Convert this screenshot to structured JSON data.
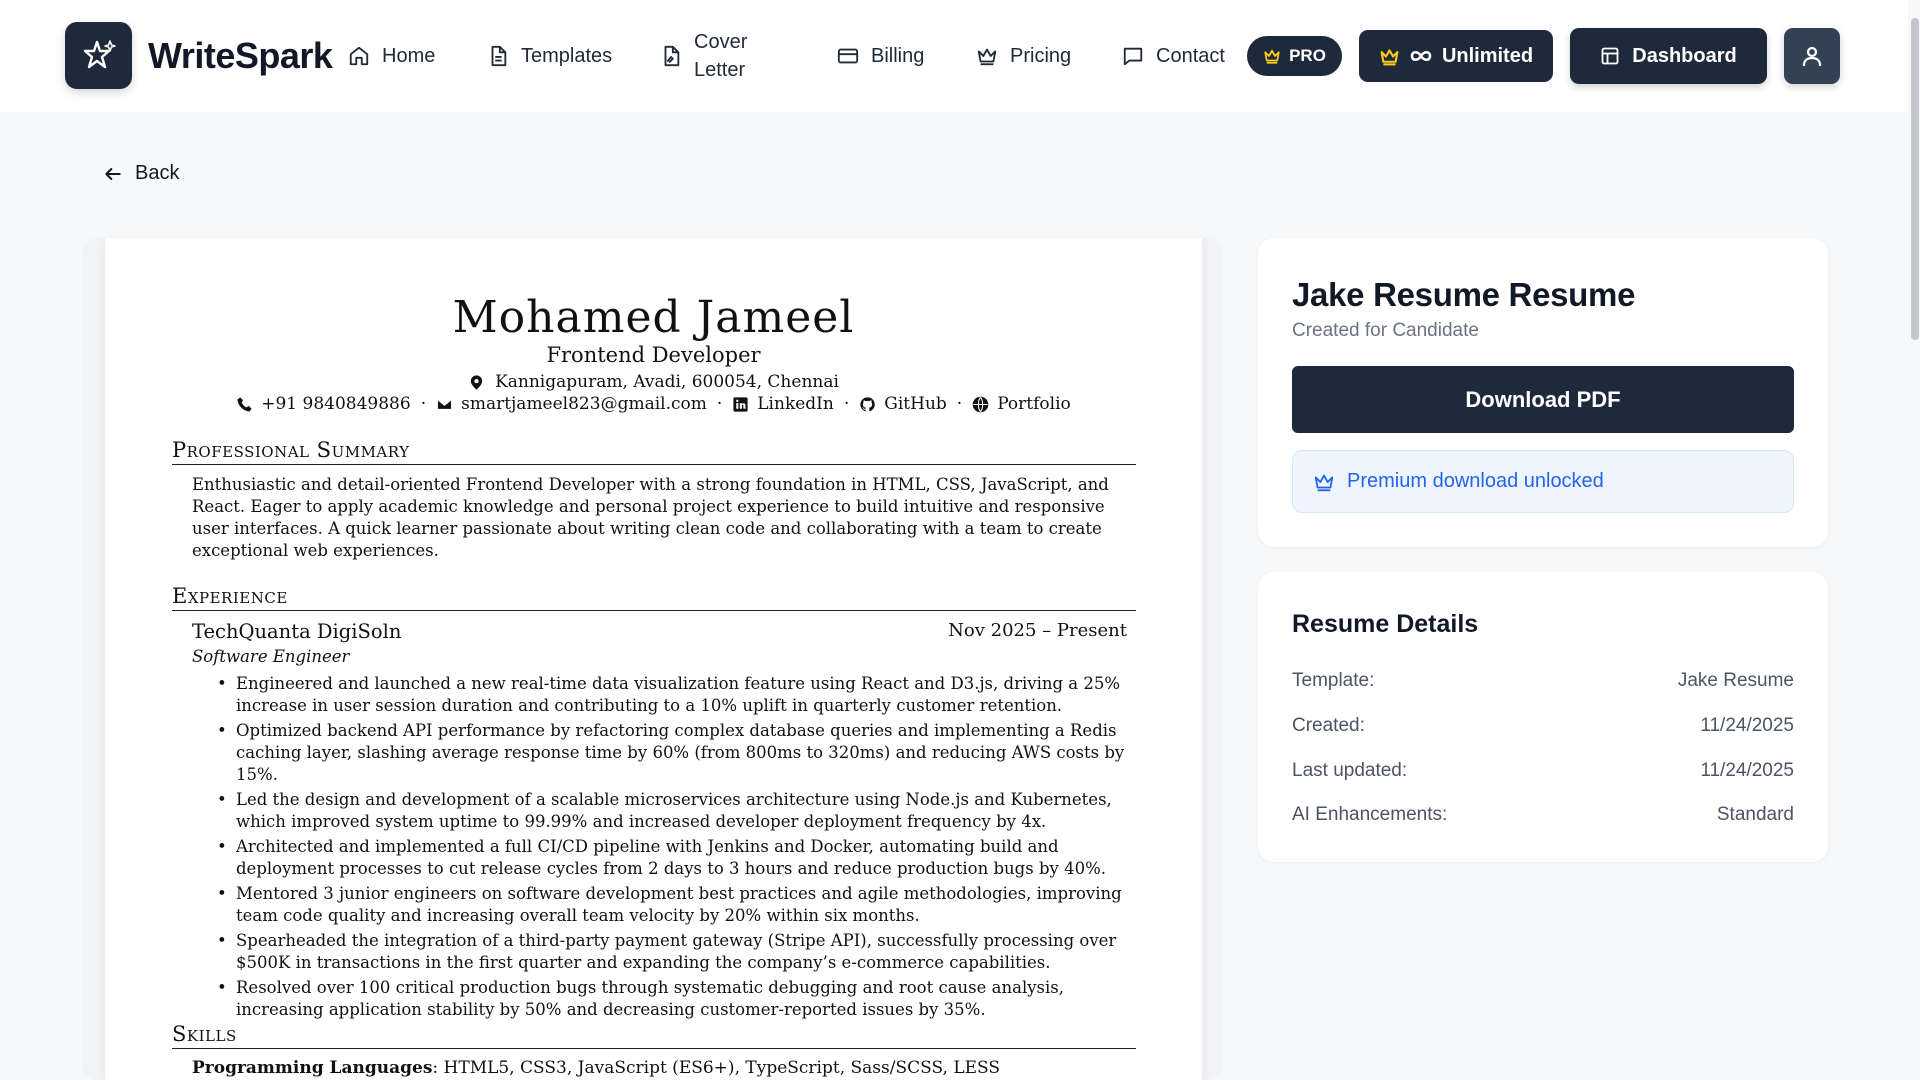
{
  "header": {
    "brand": "WriteSpark",
    "nav": [
      {
        "label": "Home",
        "icon": "home-icon"
      },
      {
        "label": "Templates",
        "icon": "file-text-icon"
      },
      {
        "label_line1": "Cover",
        "label_line2": "Letter",
        "icon": "file-signature-icon"
      },
      {
        "label": "Billing",
        "icon": "credit-card-icon"
      },
      {
        "label": "Pricing",
        "icon": "crown-icon"
      },
      {
        "label": "Contact",
        "icon": "message-square-icon"
      }
    ],
    "pro_badge": "PRO",
    "unlimited_label": "Unlimited",
    "dashboard_label": "Dashboard"
  },
  "back_label": "Back",
  "resume": {
    "name": "Mohamed Jameel",
    "title": "Frontend Developer",
    "address": "Kannigapuram, Avadi, 600054, Chennai",
    "phone": "+91 9840849886",
    "email": "smartjameel823@gmail.com",
    "linkedin": "LinkedIn",
    "github": "GitHub",
    "portfolio": "Portfolio",
    "summary_heading": "Professional Summary",
    "summary": "Enthusiastic and detail-oriented Frontend Developer with a strong foundation in HTML, CSS, JavaScript, and React. Eager to apply academic knowledge and personal project experience to build intuitive and responsive user interfaces. A quick learner passionate about writing clean code and collaborating with a team to create exceptional web experiences.",
    "experience_heading": "Experience",
    "company": "TechQuanta DigiSoln",
    "dates": "Nov 2025 – Present",
    "role": "Software Engineer",
    "bullets": [
      "Engineered and launched a new real-time data visualization feature using React and D3.js, driving a 25% increase in user session duration and contributing to a 10% uplift in quarterly customer retention.",
      "Optimized backend API performance by refactoring complex database queries and implementing a Redis caching layer, slashing average response time by 60% (from 800ms to 320ms) and reducing AWS costs by 15%.",
      "Led the design and development of a scalable microservices architecture using Node.js and Kubernetes, which improved system uptime to 99.99% and increased developer deployment frequency by 4x.",
      "Architected and implemented a full CI/CD pipeline with Jenkins and Docker, automating build and deployment processes to cut release cycles from 2 days to 3 hours and reduce production bugs by 40%.",
      "Mentored 3 junior engineers on software development best practices and agile methodologies, improving team code quality and increasing overall team velocity by 20% within six months.",
      "Spearheaded the integration of a third-party payment gateway (Stripe API), successfully processing over $500K in transactions in the first quarter and expanding the company’s e-commerce capabilities.",
      "Resolved over 100 critical production bugs through systematic debugging and root cause analysis, increasing application stability by 50% and decreasing customer-reported issues by 35%."
    ],
    "skills_heading": "Skills",
    "skills_label": "Programming Languages",
    "skills_value": ": HTML5, CSS3, JavaScript (ES6+), TypeScript, Sass/SCSS, LESS"
  },
  "sidebar": {
    "title": "Jake Resume Resume",
    "subtitle": "Created for Candidate",
    "download_label": "Download PDF",
    "notice": "Premium download unlocked",
    "details_title": "Resume Details",
    "details": [
      {
        "label": "Template:",
        "value": "Jake Resume"
      },
      {
        "label": "Created:",
        "value": "11/24/2025"
      },
      {
        "label": "Last updated:",
        "value": "11/24/2025"
      },
      {
        "label": "AI Enhancements:",
        "value": "Standard"
      }
    ]
  },
  "colors": {
    "primary_dark": "#1e293b",
    "accent_blue": "#2563eb",
    "pro_crown": "#facc15"
  }
}
